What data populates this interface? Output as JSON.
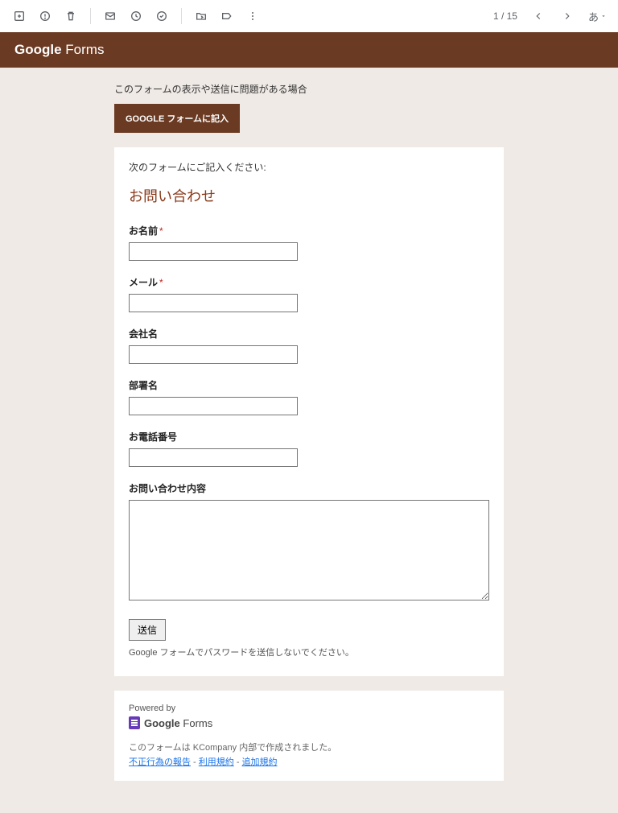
{
  "toolbar": {
    "page_indicator": "1 / 15",
    "lang": "あ"
  },
  "brand": {
    "bold": "Google",
    "thin": " Forms"
  },
  "fallback": {
    "text": "このフォームの表示や送信に問題がある場合",
    "button": "GOOGLE フォームに記入"
  },
  "form": {
    "instructions": "次のフォームにご記入ください:",
    "title": "お問い合わせ",
    "fields": {
      "name": {
        "label": "お名前",
        "required": true
      },
      "email": {
        "label": "メール",
        "required": true
      },
      "company": {
        "label": "会社名",
        "required": false
      },
      "dept": {
        "label": "部署名",
        "required": false
      },
      "phone": {
        "label": "お電話番号",
        "required": false
      },
      "message": {
        "label": "お問い合わせ内容",
        "required": false
      }
    },
    "submit": "送信",
    "pw_note": "Google フォームでパスワードを送信しないでください。"
  },
  "footer": {
    "powered": "Powered by",
    "gf_bold": "Google",
    "gf_thin": " Forms",
    "created": "このフォームは KCompany 内部で作成されました。",
    "links": {
      "abuse": "不正行為の報告",
      "terms": "利用規約",
      "additional": "追加規約"
    },
    "sep": " - "
  },
  "req_mark": "*"
}
